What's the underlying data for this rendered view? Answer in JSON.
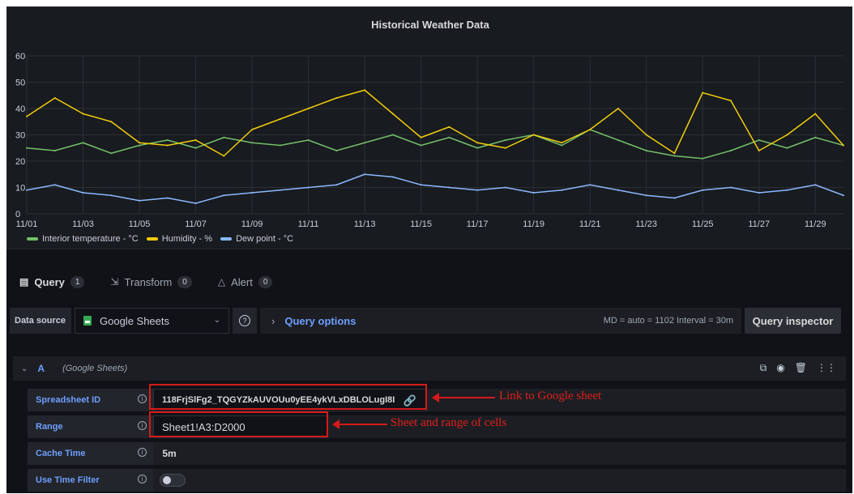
{
  "panel": {
    "title": "Historical Weather Data"
  },
  "chart_data": {
    "type": "line",
    "title": "Historical Weather Data",
    "x_ticks": [
      "11/01",
      "11/03",
      "11/05",
      "11/07",
      "11/09",
      "11/11",
      "11/13",
      "11/15",
      "11/17",
      "11/19",
      "11/21",
      "11/23",
      "11/25",
      "11/27",
      "11/29"
    ],
    "y_ticks": [
      "0",
      "10",
      "20",
      "30",
      "40",
      "50",
      "60"
    ],
    "ylim": [
      0,
      60
    ],
    "x_range": [
      "11/01",
      "11/30"
    ],
    "grid": true,
    "legend_position": "bottom-left",
    "x": [
      "11/01",
      "11/02",
      "11/03",
      "11/04",
      "11/05",
      "11/06",
      "11/07",
      "11/08",
      "11/09",
      "11/10",
      "11/11",
      "11/12",
      "11/13",
      "11/14",
      "11/15",
      "11/16",
      "11/17",
      "11/18",
      "11/19",
      "11/20",
      "11/21",
      "11/22",
      "11/23",
      "11/24",
      "11/25",
      "11/26",
      "11/27",
      "11/28",
      "11/29",
      "11/30"
    ],
    "series": [
      {
        "name": "Interior temperature - °C",
        "color": "#73bf69",
        "values": [
          25,
          24,
          27,
          23,
          26,
          28,
          25,
          29,
          27,
          26,
          28,
          24,
          27,
          30,
          26,
          29,
          25,
          28,
          30,
          26,
          32,
          28,
          24,
          22,
          21,
          24,
          28,
          25,
          29,
          26
        ]
      },
      {
        "name": "Humidity - %",
        "color": "#f2cc0c",
        "values": [
          37,
          44,
          38,
          35,
          27,
          26,
          28,
          22,
          32,
          36,
          40,
          44,
          47,
          38,
          29,
          33,
          27,
          25,
          30,
          27,
          32,
          40,
          30,
          23,
          46,
          43,
          24,
          30,
          38,
          26
        ]
      },
      {
        "name": "Dew point - °C",
        "color": "#8ab8ff",
        "values": [
          9,
          11,
          8,
          7,
          5,
          6,
          4,
          7,
          8,
          9,
          10,
          11,
          15,
          14,
          11,
          10,
          9,
          10,
          8,
          9,
          11,
          9,
          7,
          6,
          9,
          10,
          8,
          9,
          11,
          7
        ]
      }
    ]
  },
  "tabs": [
    {
      "label": "Query",
      "count": "1",
      "icon": "database-icon"
    },
    {
      "label": "Transform",
      "count": "0",
      "icon": "transform-icon"
    },
    {
      "label": "Alert",
      "count": "0",
      "icon": "bell-icon"
    }
  ],
  "datasource": {
    "label": "Data source",
    "selected": "Google Sheets",
    "help": "?",
    "query_options_label": "Query options",
    "meta": "MD = auto = 1102   Interval = 30m",
    "inspector_label": "Query inspector"
  },
  "query": {
    "ref_id": "A",
    "ds_name": "(Google Sheets)",
    "fields": {
      "spreadsheet_label": "Spreadsheet ID",
      "spreadsheet_value": "118FrjSlFg2_TQGYZkAUVOUu0yEE4ykVLxDBLOLugI8I",
      "range_label": "Range",
      "range_value": "Sheet1!A3:D2000",
      "cache_label": "Cache Time",
      "cache_value": "5m",
      "time_filter_label": "Use Time Filter",
      "time_filter_enabled": false
    }
  },
  "annotations": {
    "sheet_note": "Link to Google sheet",
    "range_note": "Sheet and range of cells",
    "color": "#d61a1a"
  }
}
